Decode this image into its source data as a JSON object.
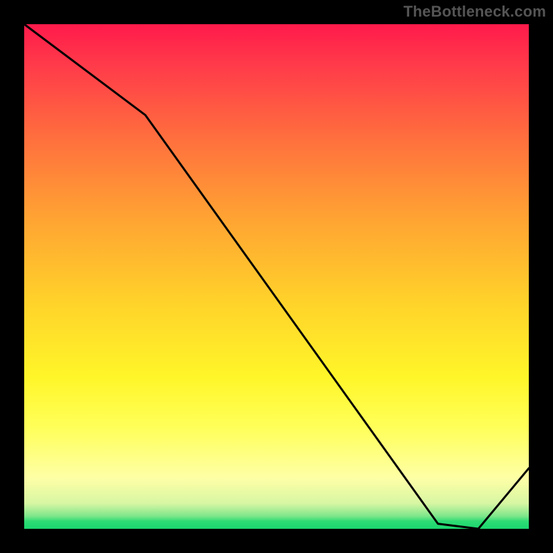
{
  "watermark": "TheBottleneck.com",
  "chart_data": {
    "type": "line",
    "title": "",
    "xlabel": "",
    "ylabel": "",
    "x": [
      0,
      24,
      82,
      90,
      100
    ],
    "values": [
      100,
      82,
      1,
      0,
      12
    ],
    "ylim": [
      0,
      100
    ],
    "xlim": [
      0,
      100
    ],
    "min_marker_text": "",
    "grid": false,
    "annotations": []
  },
  "colors": {
    "line": "#000000",
    "marker_text": "#d8463a"
  }
}
